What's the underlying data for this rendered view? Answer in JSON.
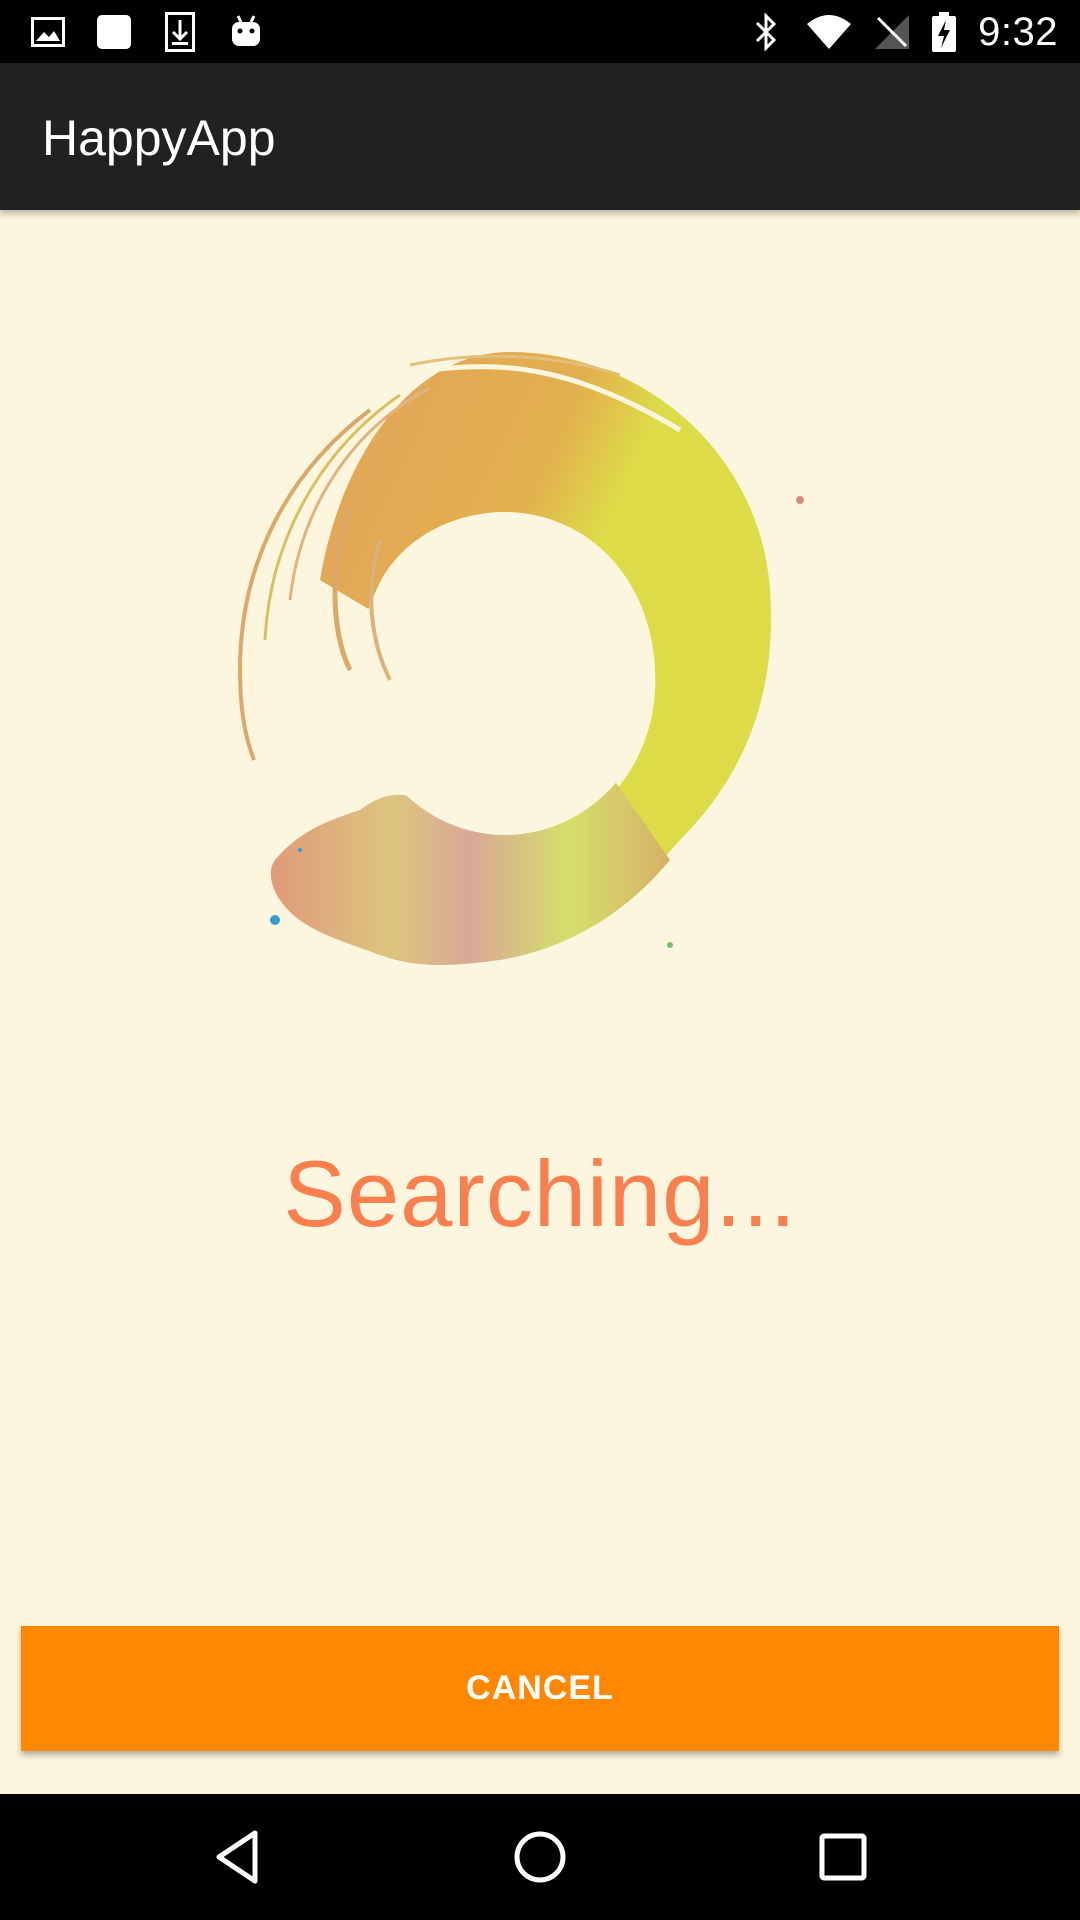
{
  "status_bar": {
    "time": "9:32",
    "left_icons": [
      "image-icon",
      "square-icon",
      "download-icon",
      "android-icon"
    ],
    "right_icons": [
      "bluetooth-icon",
      "wifi-icon",
      "no-signal-icon",
      "battery-charging-icon"
    ]
  },
  "app_bar": {
    "title": "HappyApp"
  },
  "main": {
    "status_text": "Searching...",
    "cancel_label": "CANCEL"
  },
  "nav_bar": {
    "buttons": [
      "back-icon",
      "home-icon",
      "recents-icon"
    ]
  },
  "colors": {
    "background": "#FDF6DE",
    "app_bar": "#212121",
    "accent": "#FF8800",
    "status_text": "#FA7F4E"
  }
}
